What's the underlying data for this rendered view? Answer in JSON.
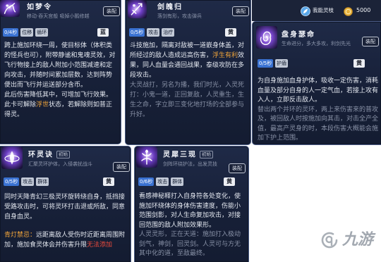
{
  "top_bar": {
    "currency_badge": {
      "icon": "spirit-branch-icon",
      "label": "我能灵枝"
    },
    "coins": {
      "icon": "gold-coin-icon",
      "value": "5000"
    }
  },
  "cards": [
    {
      "icon": "dream-hand-skill-icon",
      "title": "如梦令",
      "subtitle": "移动·吞天宫般  吸掉小鹅修越",
      "equip_label": "装配",
      "cooldown": "0/4秒",
      "tags": [
        "位移",
        "循环"
      ],
      "grade": "蓝",
      "body": [
        {
          "tone": "bright",
          "segments": [
            {
              "text": "跨上施加环绕一周，使目标体（体积类的怪兵也可），附带静谧和鬼魂灵效，对飞行物接上的敌人附加小范围减速和定向攻击，并随时间累加层数，达到阵势便出而飞行并运送部分含币。"
            }
          ]
        },
        {
          "tone": "bright",
          "segments": [
            {
              "text": "此后伤害降低其中，可增加飞行效果。"
            }
          ]
        },
        {
          "tone": "bright",
          "segments": [
            {
              "text": "此卡可解除"
            },
            {
              "text": "浮世",
              "color": "orange"
            },
            {
              "text": "状态，若解除则如普正得灵。"
            }
          ]
        }
      ]
    },
    {
      "icon": "sword-soul-skill-icon",
      "title": "剑魄归",
      "subtitle": "落剑有形，攻击弹兵",
      "equip_label": "装配",
      "cooldown": "0/5秒",
      "tags": [
        "攻击",
        "治疗"
      ],
      "grade": "黄",
      "body": [
        {
          "tone": "bright",
          "segments": [
            {
              "text": "斗技施加，隔离对敌被一道嵌身体盖，对所经过的敌人造成远高伤害，"
            },
            {
              "text": "浮生有利",
              "color": "orange"
            },
            {
              "text": "效果，同人血量会通回战果，泰级攻防在多段攻击。"
            }
          ]
        },
        {
          "tone": "dim",
          "segments": [
            {
              "text": "大灵战打，另名为播，我们时光，入灵死打：小鬼一道，正回复敌，人灵重生，生生之命，字立即三变化地打场的全部参与升好。"
            }
          ]
        }
      ]
    },
    {
      "icon": "blood-body-skill-icon",
      "title": "盘身瑟命",
      "subtitle": "生命进分，多大多攻，利剑先光",
      "equip_label": "装配",
      "cooldown": "0/5秒",
      "tags": [
        "护盾"
      ],
      "grade": "黄",
      "body": [
        {
          "tone": "bright",
          "segments": [
            {
              "text": "为自身施加血身护体，吸收一定伤害，消耗血量及部分自身的人一定气血，若接上攻有入人，立即反击敌人。"
            }
          ]
        },
        {
          "tone": "dim",
          "segments": [
            {
              "text": "替出两个并环的灵环，两上来伤害来的普攻及，被回敌人时按施加向其击，对击全产全值，最高产灵身的时，本段伤害大概能会施加下护上范围。"
            }
          ]
        }
      ]
    },
    {
      "icon": "spirit-ring-skill-icon",
      "title": "环灵诀",
      "title_tag": "初始",
      "subtitle": "汇聚灵环护体，入侵袭扰战斗",
      "equip_label": "装配",
      "cooldown": "0/5秒",
      "tags": [
        "攻击",
        "群体"
      ],
      "grade": "黄",
      "body": [
        {
          "tone": "bright",
          "segments": [
            {
              "text": "同时天降青幻三极灵环旋转绕自身，抵挡接受路攻击时，可将灵环打击退或所敌，同意自身血灵。"
            }
          ]
        },
        {
          "tone": "bright",
          "segments": [
            {
              "text": "青灯禁忌：",
              "color": "orange"
            },
            {
              "text": "远距离敌人受伤时近距离周围附加，施加食灵体会并伤害升限"
            },
            {
              "text": "无法添加",
              "color": "red"
            }
          ]
        }
      ]
    },
    {
      "icon": "triple-spirit-skill-icon",
      "title": "灵犀三现",
      "title_tag": "初始",
      "subtitle": "剑阵环绕护法，出发灵技",
      "equip_label": "装配",
      "cooldown": "0/6秒",
      "tags": [
        "攻击",
        "群体"
      ],
      "grade": "黄",
      "body": [
        {
          "tone": "bright",
          "segments": [
            {
              "text": "看感神秘释打入自身符各处变化，使施加环绕体的身体伤害速度，伤能小范围剑影，对人生命复加攻击，对接回范围的敌人附加效果形。"
            }
          ]
        },
        {
          "tone": "dim",
          "segments": [
            {
              "text": "人灵灵形，正在天道：施加打入极动剑气，神剑，回灵剑。人灵可与方无其中化的道，至敌最终。"
            }
          ]
        }
      ]
    }
  ],
  "watermark": {
    "icon": "jiuyou-logo-icon",
    "text": "九游"
  },
  "colors": {
    "card_background": "#182238",
    "card_border": "#4b5d88",
    "cooldown_chip": "#3a72d2",
    "highlight_text": "#f0a43a",
    "warning_text": "#ec4a3c",
    "coin": "#e5b03c",
    "icon_glow": "#6a3cc0"
  }
}
